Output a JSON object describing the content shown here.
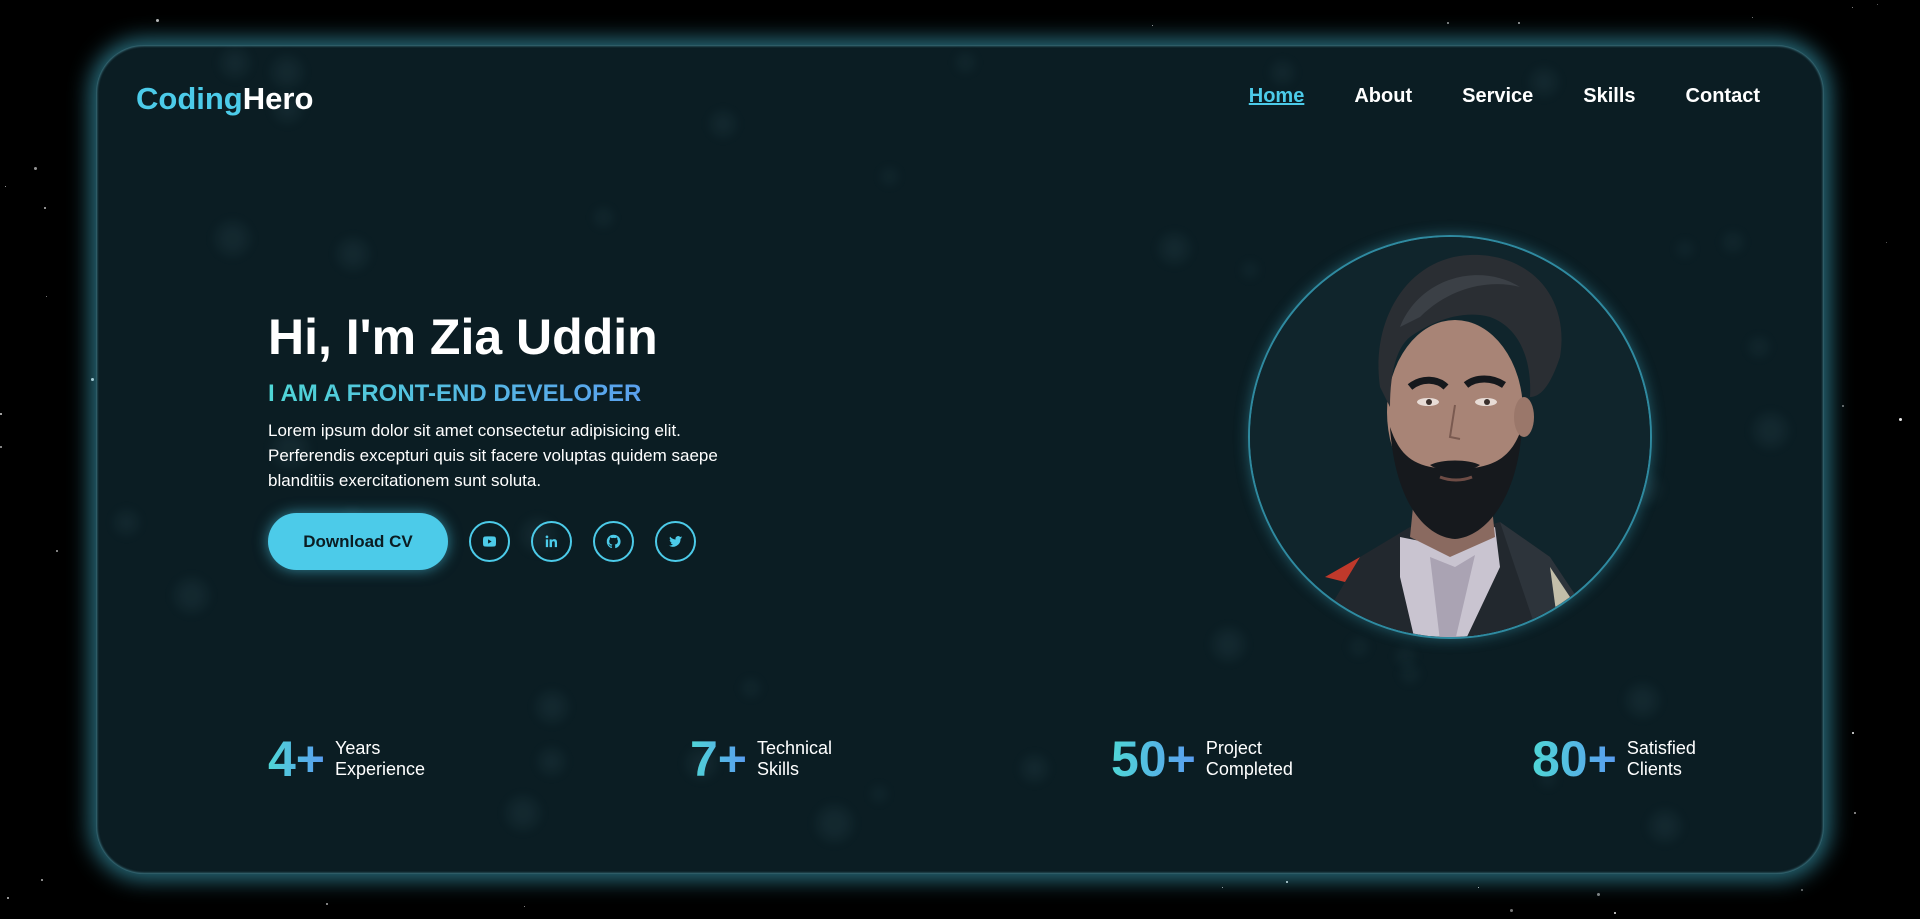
{
  "brand": {
    "part1": "Coding",
    "part2": "Hero"
  },
  "nav": [
    {
      "label": "Home",
      "active": true
    },
    {
      "label": "About",
      "active": false
    },
    {
      "label": "Service",
      "active": false
    },
    {
      "label": "Skills",
      "active": false
    },
    {
      "label": "Contact",
      "active": false
    }
  ],
  "hero": {
    "title": "Hi, I'm Zia Uddin",
    "subtitle": "I AM A FRONT-END DEVELOPER",
    "description": "Lorem ipsum dolor sit amet consectetur adipisicing elit. Perferendis excepturi quis sit facere voluptas quidem saepe blanditiis exercitationem sunt soluta.",
    "cta_label": "Download CV",
    "socials": [
      "youtube-icon",
      "linkedin-icon",
      "github-icon",
      "twitter-icon"
    ]
  },
  "stats": [
    {
      "number": "4+",
      "line1": "Years",
      "line2": "Experience"
    },
    {
      "number": "7+",
      "line1": "Technical",
      "line2": "Skills"
    },
    {
      "number": "50+",
      "line1": "Project",
      "line2": "Completed"
    },
    {
      "number": "80+",
      "line1": "Satisfied",
      "line2": "Clients"
    }
  ],
  "colors": {
    "accent": "#4ccbe9",
    "card_bg": "#0b1d23",
    "page_bg": "#000000"
  }
}
